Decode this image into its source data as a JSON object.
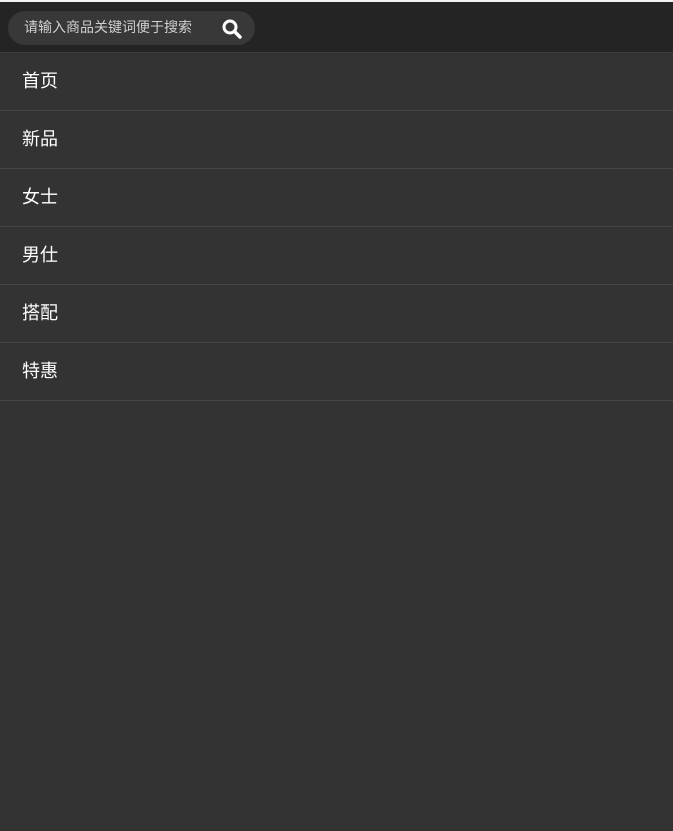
{
  "search": {
    "placeholder": "请输入商品关键词便于搜索",
    "icon": "search-icon"
  },
  "nav": {
    "items": [
      {
        "label": "首页"
      },
      {
        "label": "新品"
      },
      {
        "label": "女士"
      },
      {
        "label": "男仕"
      },
      {
        "label": "搭配"
      },
      {
        "label": "特惠"
      }
    ]
  },
  "colors": {
    "background": "#333333",
    "header": "#242424",
    "search_box": "#383838",
    "text": "#ffffff",
    "divider": "#454545"
  }
}
